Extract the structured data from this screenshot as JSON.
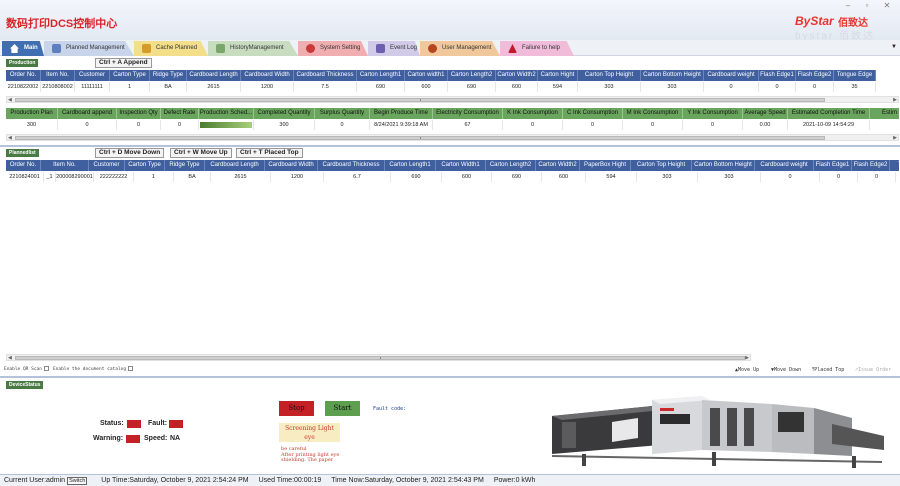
{
  "app": {
    "title": "数码打印DCS控制中心",
    "logo": "ByStar",
    "logo_cn": "佰致达",
    "logo_shadow": "bystar 佰致达"
  },
  "window": {
    "minimize": "–",
    "restore": "▫",
    "close": "✕"
  },
  "tabs": [
    {
      "label": "Main",
      "icon": "home-icon",
      "color": "#3f6fb0",
      "active": true
    },
    {
      "label": "Planned Management",
      "icon": "clipboard-icon",
      "color": "#c7d4ea"
    },
    {
      "label": "Cache Planned",
      "icon": "folder-icon",
      "color": "#f3de8a"
    },
    {
      "label": "HistoryManagement",
      "icon": "history-icon",
      "color": "#c8dcc0"
    },
    {
      "label": "System Setting",
      "icon": "gear-icon",
      "color": "#f1aeb0"
    },
    {
      "label": "Event Log",
      "icon": "log-icon",
      "color": "#d1cbe8"
    },
    {
      "label": "User Management",
      "icon": "user-icon",
      "color": "#f0c89c"
    },
    {
      "label": "Failure to help",
      "icon": "help-icon",
      "color": "#f0bcd9"
    }
  ],
  "production": {
    "label": "Production",
    "append_button": "Ctrl + A Append",
    "headers": [
      "Order No.",
      "Item No.",
      "Customer",
      "Carton Type",
      "Ridge Type",
      "Cardboard Length",
      "Cardboard Width",
      "Cardboard Thickness",
      "Carton Length1",
      "Carton width1",
      "Carton Length2",
      "Carton Width2",
      "Carton Hight",
      "Carton Top Height",
      "Carton Bottom Height",
      "Cardboard weight",
      "Flash Edge1",
      "Flash Edge2",
      "Tongue Edge"
    ],
    "row": [
      "2210822002",
      "2210808002",
      "11111111",
      "1",
      "BA",
      "2615",
      "1200",
      "7.5",
      "690",
      "600",
      "690",
      "600",
      "594",
      "303",
      "303",
      "0",
      "0",
      "0",
      "35"
    ],
    "headers2": [
      "Production Plan",
      "Cardboard append",
      "Inspection Qty",
      "Defect Rate",
      "Production Sched...",
      "Completed Quantity",
      "Surplus Quantity",
      "Begin Produce Time",
      "Electricity Consumption",
      "K Ink Consumption",
      "C Ink Consumption",
      "M Ink Consumption",
      "Y Ink Consumption",
      "Average Speed",
      "Estimated Completion Time",
      "Estim"
    ],
    "row2": [
      "300",
      "0",
      "0",
      "0",
      "",
      "300",
      "0",
      "8/24/2021 9:39:18 AM",
      "67",
      "0",
      "0",
      "0",
      "0",
      "0.00",
      "2021-10-09 14:54:29",
      ""
    ],
    "progress": 1.0
  },
  "plannedlist": {
    "label": "Plannedlist",
    "buttons": [
      "Ctrl + D Move Down",
      "Ctrl + W Move Up",
      "Ctrl + T Placed Top"
    ],
    "headers": [
      "Order No.",
      "Item No.",
      "Customer",
      "Carton Type",
      "Ridge Type",
      "Cardboard Length",
      "Cardboard Width",
      "Cardboard Thickness",
      "Carton Length1",
      "Carton Width1",
      "Carton Length2",
      "Carton Width2",
      "PaperBox Hight",
      "Carton Top Height",
      "Carton Bottom Height",
      "Cardboard weight",
      "Flash Edge1",
      "Flash Edge2",
      "Tong"
    ],
    "row": [
      "2210824001",
      "_1",
      "200008290001",
      "222222222",
      "1",
      "BA",
      "2615",
      "1200",
      "6.7",
      "690",
      "600",
      "690",
      "600",
      "594",
      "303",
      "303",
      "0",
      "0",
      "0"
    ]
  },
  "options": {
    "qr_scan": "Enable QR Scan",
    "doc_catalog": "Enable the document catalog"
  },
  "actions": {
    "move_up": "Move Up",
    "move_down": "Move Down",
    "placed_top": "Placed Top",
    "issue_order": "Issue Order"
  },
  "device": {
    "label": "DeviceStatus",
    "status_label": "Status:",
    "fault_label": "Fault:",
    "warning_label": "Warning:",
    "speed_label": "Speed:",
    "speed_value": "NA",
    "stop": "Stop",
    "start": "Start",
    "warn_title": "Screening Light eye",
    "warn_text": "be careful\nAfter printing light eye\nshielding. The paper",
    "fault_code": "Fault code:"
  },
  "statusbar": {
    "user": "Current User:admin",
    "switch": "Switch",
    "uptime": "Up Time:Saturday, October 9, 2021 2:54:24 PM",
    "used": "Used Time:00:00:19",
    "now": "Time Now:Saturday, October 9, 2021 2:54:43 PM",
    "power": "Power:0 kWh"
  },
  "colors": {
    "header_blue": "#3f5f9f",
    "header_green": "#6aa55e",
    "stop_red": "#c42127",
    "start_green": "#5e9e4f"
  }
}
